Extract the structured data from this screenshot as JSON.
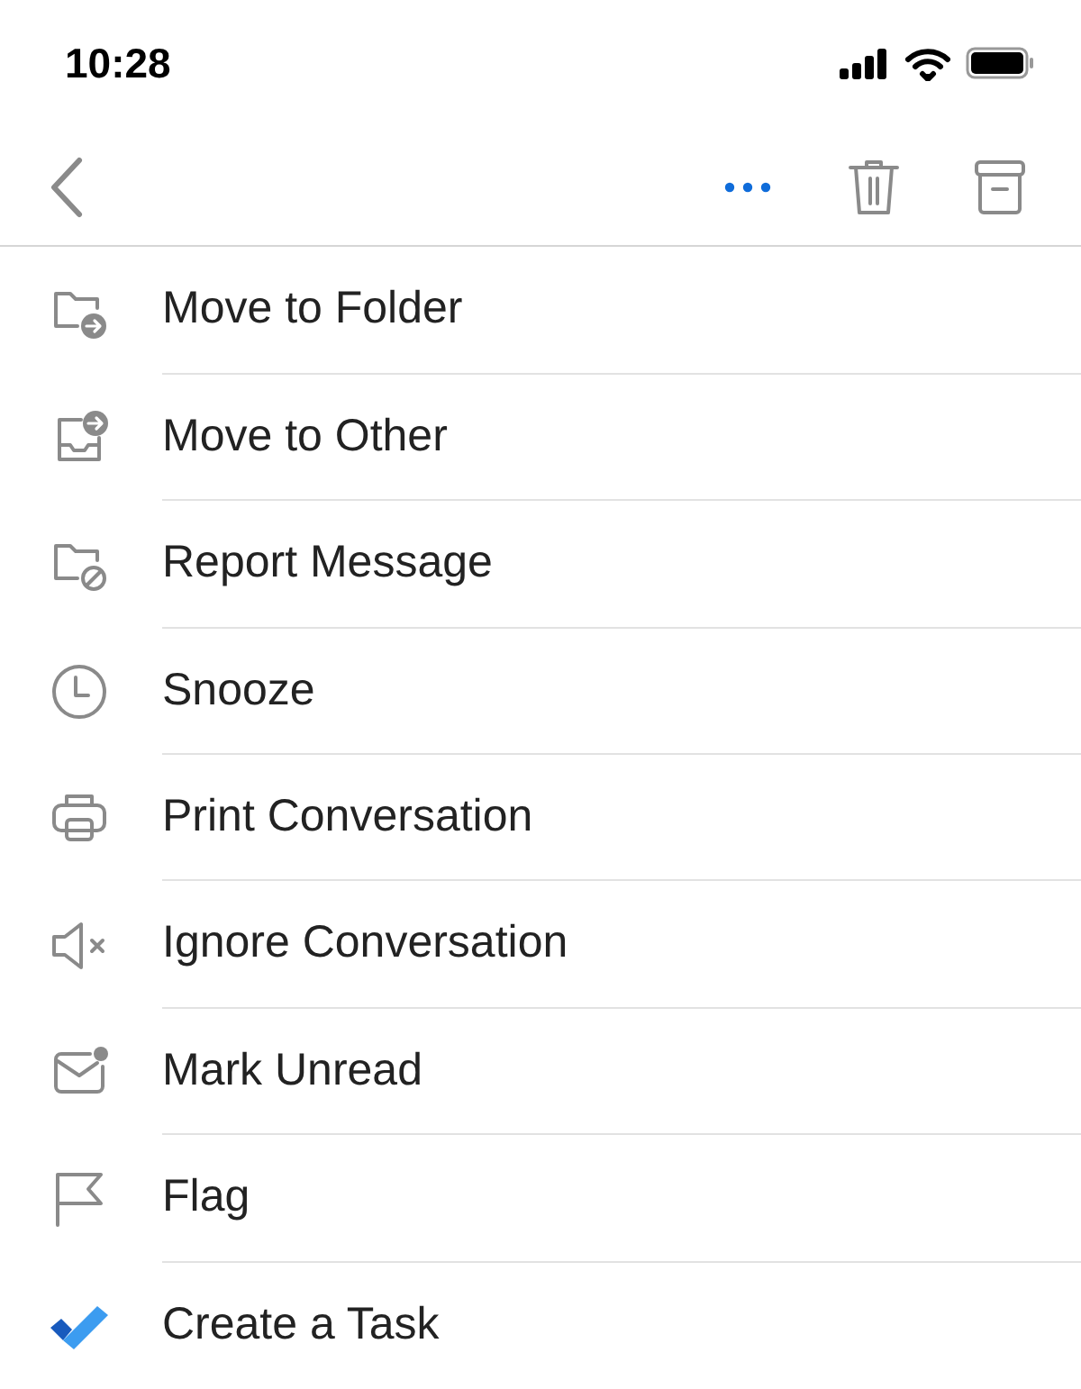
{
  "status_bar": {
    "time": "10:28"
  },
  "actions": [
    {
      "label": "Move to Folder",
      "kind": "move-folder"
    },
    {
      "label": "Move to Other",
      "kind": "move-other"
    },
    {
      "label": "Report Message",
      "kind": "report"
    },
    {
      "label": "Snooze",
      "kind": "snooze"
    },
    {
      "label": "Print Conversation",
      "kind": "print"
    },
    {
      "label": "Ignore Conversation",
      "kind": "ignore"
    },
    {
      "label": "Mark Unread",
      "kind": "unread"
    },
    {
      "label": "Flag",
      "kind": "flag"
    },
    {
      "label": "Create a Task",
      "kind": "task"
    }
  ]
}
